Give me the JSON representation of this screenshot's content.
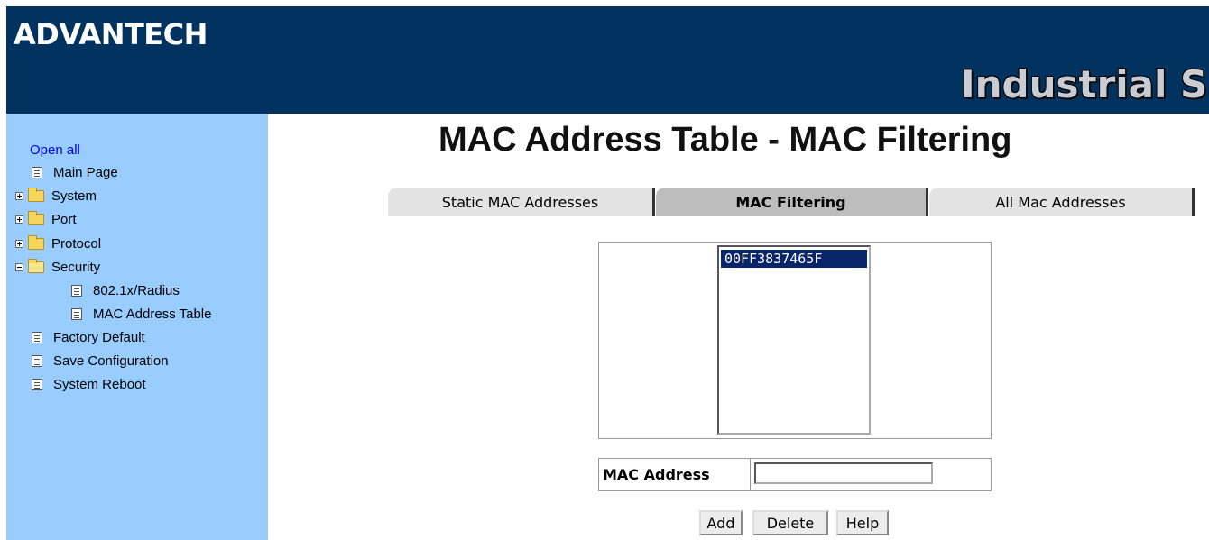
{
  "header": {
    "logo": "ADVANTECH",
    "brand": "Industrial S"
  },
  "sidebar": {
    "open_all": "Open all",
    "items": [
      {
        "label": "Main Page"
      },
      {
        "label": "System"
      },
      {
        "label": "Port"
      },
      {
        "label": "Protocol"
      },
      {
        "label": "Security"
      },
      {
        "label": "802.1x/Radius"
      },
      {
        "label": "MAC Address Table"
      },
      {
        "label": "Factory Default"
      },
      {
        "label": "Save Configuration"
      },
      {
        "label": "System Reboot"
      }
    ]
  },
  "main": {
    "title": "MAC Address Table - MAC Filtering",
    "tabs": [
      {
        "label": "Static MAC Addresses"
      },
      {
        "label": "MAC Filtering"
      },
      {
        "label": "All Mac Addresses"
      }
    ],
    "mac_list": [
      "00FF3837465F"
    ],
    "form": {
      "mac_label": "MAC Address",
      "mac_value": ""
    },
    "buttons": {
      "add": "Add",
      "delete": "Delete",
      "help": "Help"
    }
  }
}
